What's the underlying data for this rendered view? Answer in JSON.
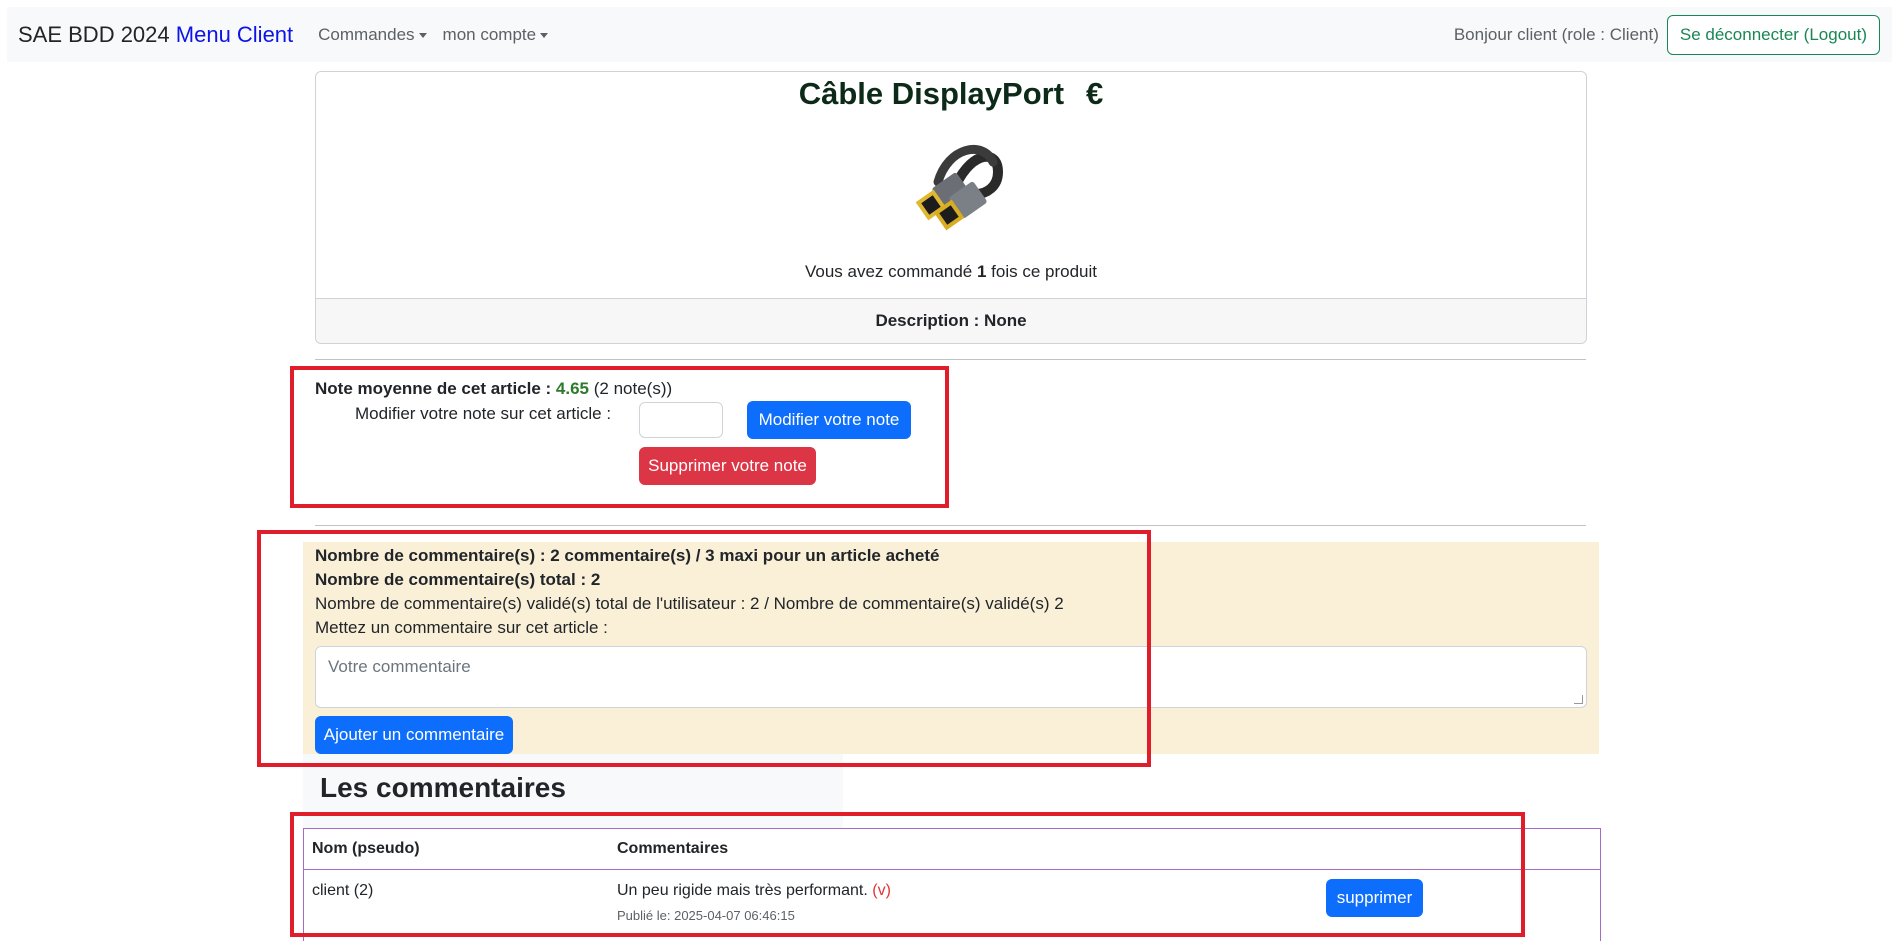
{
  "navbar": {
    "brand": "SAE BDD 2024",
    "menu": "Menu Client",
    "orders": "Commandes",
    "account": "mon compte",
    "greeting": "Bonjour client (role : Client)",
    "logout": "Se déconnecter (Logout)"
  },
  "product": {
    "title": "Câble DisplayPort",
    "currency": "€",
    "ordered_prefix": "Vous avez commandé",
    "ordered_count": "1",
    "ordered_suffix": "fois ce produit",
    "description": "Description : None"
  },
  "rating": {
    "avg_label": "Note moyenne de cet article :",
    "avg_value": "4.65",
    "count": "(2 note(s))",
    "modify_label": "Modifier votre note sur cet article :",
    "input_value": "",
    "modify_button": "Modifier votre note",
    "delete_button": "Supprimer votre note"
  },
  "comments_form": {
    "line1": "Nombre de commentaire(s) : 2 commentaire(s) / 3 maxi pour un article acheté",
    "line2": "Nombre de commentaire(s) total : 2",
    "line3": "Nombre de commentaire(s) validé(s) total de l'utilisateur : 2 / Nombre de commentaire(s) validé(s) 2",
    "line4": "Mettez un commentaire sur cet article :",
    "placeholder": "Votre commentaire",
    "add_button": "Ajouter un commentaire"
  },
  "comments": {
    "title": "Les commentaires",
    "headers": [
      "Nom (pseudo)",
      "Commentaires"
    ],
    "rows": [
      {
        "name": "client (2)",
        "text": "Un peu rigide mais très performant.",
        "flag": "(v)",
        "published": "Publié le: 2025-04-07 06:46:15",
        "action": "supprimer"
      }
    ]
  },
  "colors": {
    "primary": "#0d6efd",
    "danger": "#dc3545",
    "success": "#198754",
    "annotation": "#e01e2b",
    "comment_bg": "#faf0d7"
  }
}
